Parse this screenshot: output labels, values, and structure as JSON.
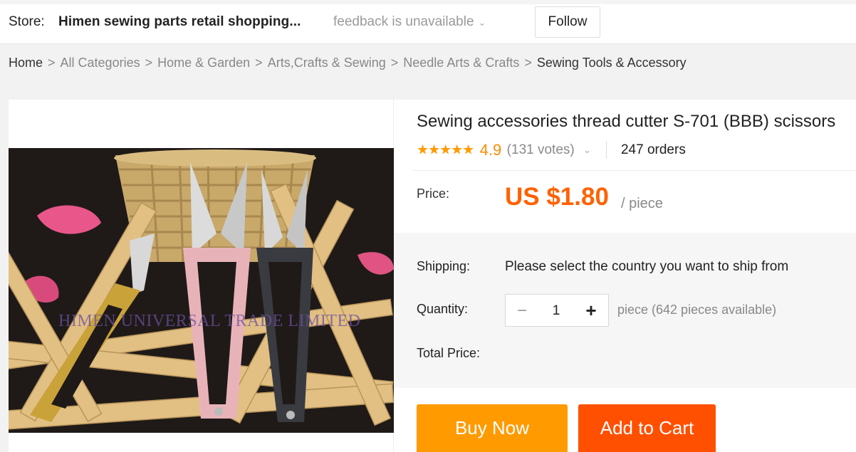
{
  "store": {
    "label": "Store:",
    "name": "Himen sewing parts retail shopping...",
    "feedback": "feedback is unavailable",
    "follow": "Follow"
  },
  "breadcrumb": [
    "Home",
    "All Categories",
    "Home & Garden",
    "Arts,Crafts & Sewing",
    "Needle Arts & Crafts",
    "Sewing Tools & Accessory"
  ],
  "product": {
    "title": "Sewing accessories thread cutter S-701 (BBB) scissors",
    "stars": "★★★★★",
    "rating": "4.9",
    "votes": "(131 votes)",
    "orders": "247 orders",
    "price_label": "Price:",
    "price": "US $1.80",
    "price_unit": "/ piece",
    "image_watermark": "HIMEN UNIVERSAL TRADE LIMITED"
  },
  "options": {
    "shipping_label": "Shipping:",
    "shipping_value": "Please select the country you want to ship from",
    "quantity_label": "Quantity:",
    "quantity_value": "1",
    "quantity_note": "piece (642 pieces available)",
    "total_label": "Total Price:"
  },
  "actions": {
    "buy_now": "Buy Now",
    "add_to_cart": "Add to Cart"
  },
  "colors": {
    "price": "#ff6200",
    "stars": "#ff9a00",
    "buy_now": "#ff9a00",
    "add_to_cart": "#ff4f00"
  }
}
